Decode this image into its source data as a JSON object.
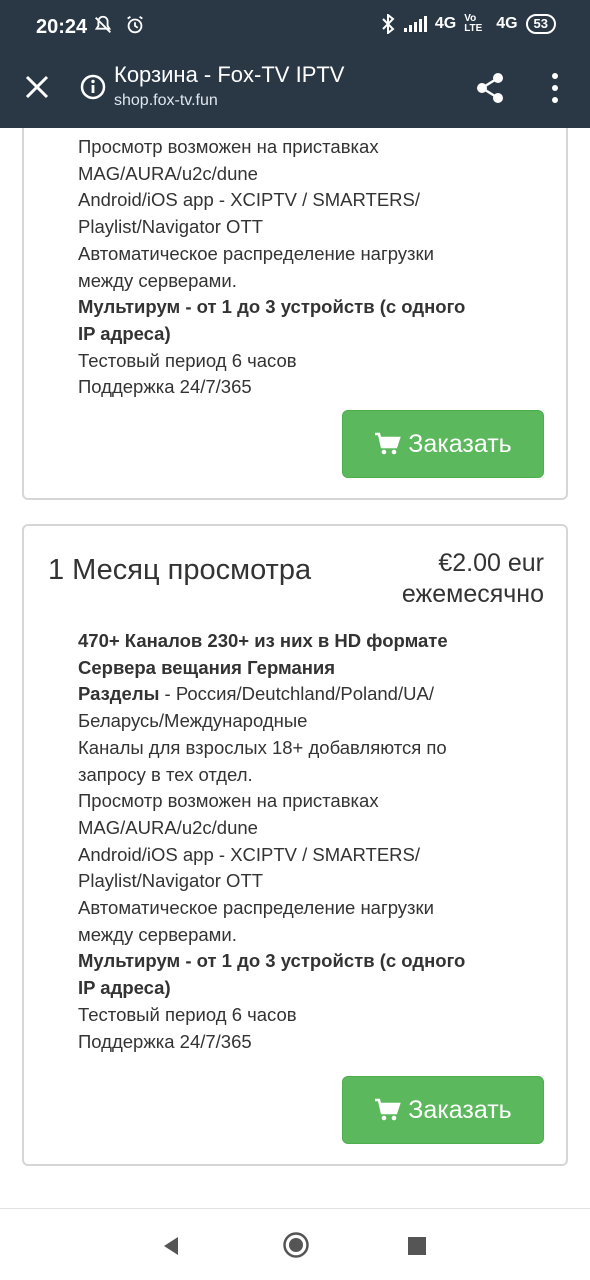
{
  "status_bar": {
    "time": "20:24",
    "network_1": "4G",
    "volte": "Vo LTE",
    "network_2": "4G",
    "battery": "53"
  },
  "toolbar": {
    "title": "Корзина - Fox-TV IPTV",
    "url": "shop.fox-tv.fun"
  },
  "card1": {
    "lines": [
      {
        "text": "Просмотр возможен на приставках",
        "bold": false
      },
      {
        "text": "MAG/AURA/u2c/dune",
        "bold": false
      },
      {
        "text": "Android/iOS app - XCIPTV / SMARTERS/",
        "bold": false
      },
      {
        "text": "Playlist/Navigator OTT",
        "bold": false
      },
      {
        "text": "Автоматическое распределение нагрузки",
        "bold": false
      },
      {
        "text": "между серверами.",
        "bold": false
      },
      {
        "text": "Мультирум - от 1 до 3 устройств (с одного",
        "bold": true
      },
      {
        "text": "IP адреса)",
        "bold": true
      },
      {
        "text": "Тестовый период 6 часов",
        "bold": false
      },
      {
        "text": "Поддержка 24/7/365",
        "bold": false
      }
    ],
    "order_label": "Заказать"
  },
  "card2": {
    "name": "1 Месяц просмотра",
    "price": "€2.00 eur",
    "period": "ежемесячно",
    "line1": "470+ Каналов 230+ из них в HD формате",
    "line2": "Сервера вещания Германия",
    "sections_label": "Разделы",
    "sections_value": " - Россия/Deutchland/Poland/UA/",
    "line4": "Беларусь/Международные",
    "line5": "Каналы для взрослых 18+ добавляются по",
    "line6": "запросу в тех отдел.",
    "line7": "Просмотр возможен на приставках",
    "line8": "MAG/AURA/u2c/dune",
    "line9": "Android/iOS app - XCIPTV / SMARTERS/",
    "line10": "Playlist/Navigator OTT",
    "line11": "Автоматическое распределение нагрузки",
    "line12": "между серверами.",
    "line13": "Мультирум - от 1 до 3 устройств (с одного",
    "line14": "IP адреса)",
    "line15": "Тестовый период 6 часов",
    "line16": "Поддержка 24/7/365",
    "order_label": "Заказать"
  },
  "colors": {
    "header_bg": "#2a3846",
    "order_button": "#5cb85c"
  }
}
